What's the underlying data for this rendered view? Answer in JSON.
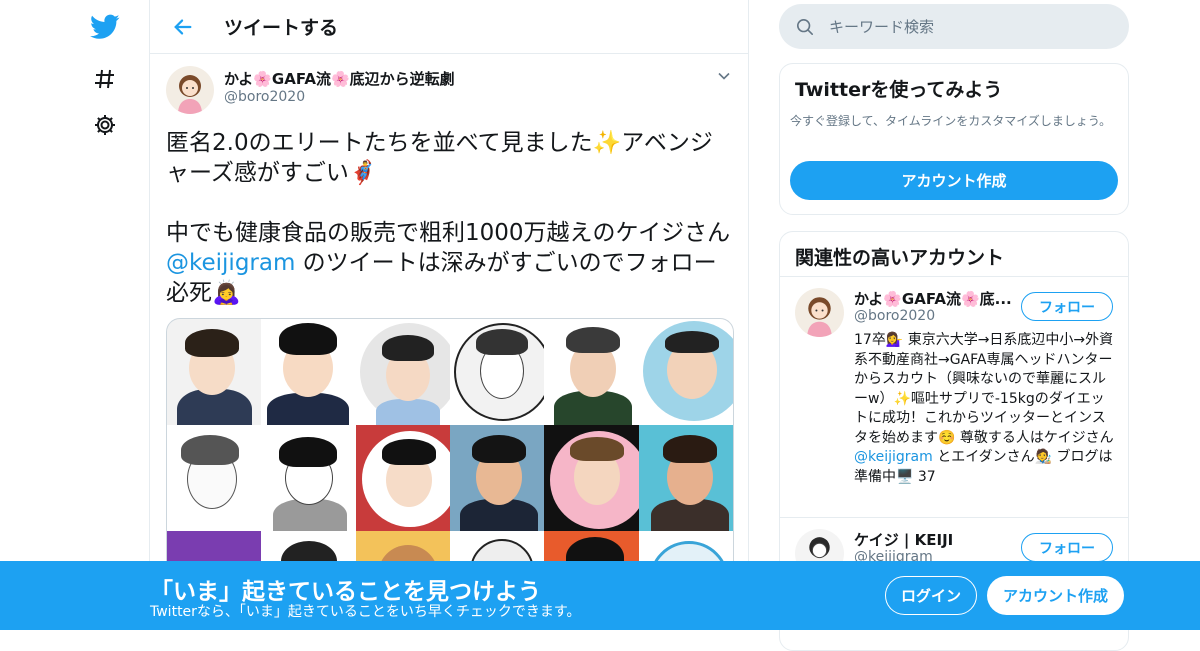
{
  "colors": {
    "brand": "#1da1f2",
    "mention": "#1b95e0",
    "muted": "#657786",
    "border": "#e6ecf0"
  },
  "nav": {
    "icons": [
      "twitter-bird-icon",
      "hashtag-icon",
      "gear-icon"
    ]
  },
  "header": {
    "title": "ツイートする"
  },
  "tweet": {
    "author_name": "かよ🌸GAFA流🌸底辺から逆転劇",
    "author_handle": "@boro2020",
    "text_part1": "匿名2.0のエリートたちを並べて見ました✨アベンジャーズ感がすごい🦸‍♂️\n\n中でも健康食品の販売で粗利1000万越えのケイジさん ",
    "mention": "@keijigram",
    "text_part2": " のツイートは深みがすごいのでフォロー必死🙇‍♀️"
  },
  "search": {
    "placeholder": "キーワード検索"
  },
  "signup_card": {
    "title": "Twitterを使ってみよう",
    "description": "今すぐ登録して、タイムラインをカスタマイズしましょう。",
    "button": "アカウント作成"
  },
  "related": {
    "title": "関連性の高いアカウント",
    "accounts": [
      {
        "name": "かよ🌸GAFA流🌸底...",
        "handle": "@boro2020",
        "follow_label": "フォロー",
        "bio_part1": "17卒💁‍♀️ 東京六大学→日系底辺中小→外資系不動産商社→GAFA専属ヘッドハンターからスカウト（興味ないので華麗にスルーw）✨嘔吐サプリで-15kgのダイエットに成功！これからツイッターとインスタを始めます☺️ 尊敬する人はケイジさん ",
        "bio_mention": "@keijigram",
        "bio_part2": " とエイダンさん🧑‍🎨 ブログは準備中🖥️ 37"
      },
      {
        "name": "ケイジ | KEIJI",
        "handle": "@keijigram",
        "follow_label": "フォロー"
      }
    ]
  },
  "bottom_bar": {
    "title": "「いま」起きていることを見つけよう",
    "subtitle": "Twitterなら、「いま」起きていることをいち早くチェックできます。",
    "login": "ログイン",
    "signup": "アカウント作成"
  }
}
